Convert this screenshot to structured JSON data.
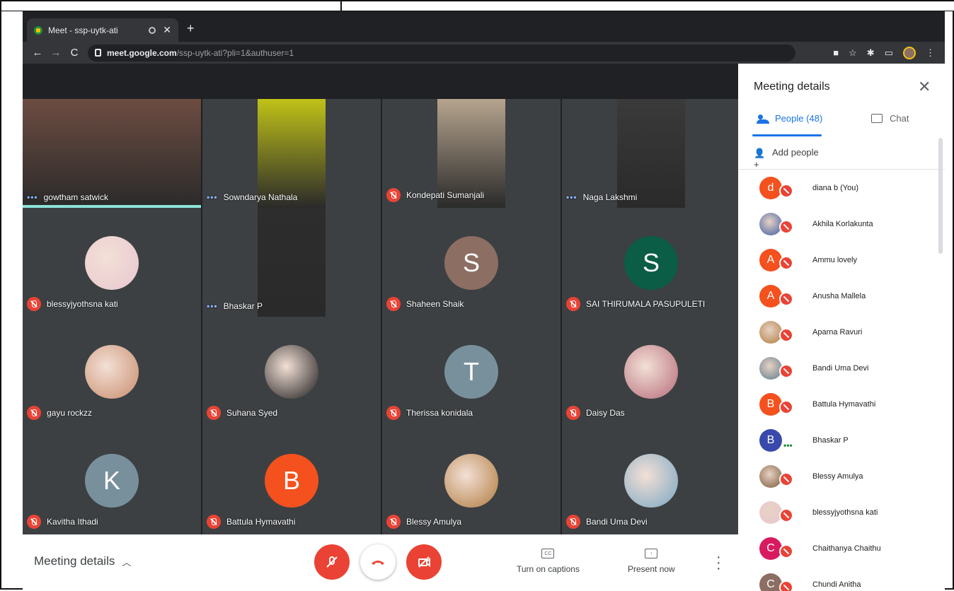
{
  "browser": {
    "tab_title": "Meet - ssp-uytk-ati",
    "url_host": "meet.google.com",
    "url_rest": "/ssp-uytk-ati?pli=1&authuser=1"
  },
  "tiles": [
    {
      "name": "gowtham satwick",
      "status": "dots",
      "kind": "video",
      "color": "#6d4c41"
    },
    {
      "name": "Sowndarya Nathala",
      "status": "dots",
      "kind": "video",
      "color": "#c0c218"
    },
    {
      "name": "Kondepati Sumanjali",
      "status": "muted",
      "kind": "video",
      "color": "#b6a48e"
    },
    {
      "name": "Naga Lakshmi",
      "status": "dots",
      "kind": "video",
      "color": "#3a3a3a"
    },
    {
      "name": "blessyjyothsna kati",
      "status": "muted",
      "kind": "photo",
      "color": "#e8c7d0"
    },
    {
      "name": "Bhaskar P",
      "status": "dots",
      "kind": "video",
      "color": "#2d2d2d"
    },
    {
      "name": "Shaheen Shaik",
      "status": "muted",
      "kind": "letter",
      "letter": "S",
      "color": "#8d6e63"
    },
    {
      "name": "SAI THIRUMALA PASUPULETI",
      "status": "muted",
      "kind": "letter",
      "letter": "S",
      "color": "#0b5d45"
    },
    {
      "name": "gayu rockzz",
      "status": "muted",
      "kind": "photo",
      "color": "#c98c6c"
    },
    {
      "name": "Suhana Syed",
      "status": "muted",
      "kind": "photo",
      "color": "#1b1b1b"
    },
    {
      "name": "Therissa konidala",
      "status": "muted",
      "kind": "letter",
      "letter": "T",
      "color": "#78909c"
    },
    {
      "name": "Daisy Das",
      "status": "muted",
      "kind": "photo",
      "color": "#b56b79"
    },
    {
      "name": "Kavitha Ithadi",
      "status": "muted",
      "kind": "letter",
      "letter": "K",
      "color": "#78909c"
    },
    {
      "name": "Battula Hymavathi",
      "status": "muted",
      "kind": "letter",
      "letter": "B",
      "color": "#f4511e"
    },
    {
      "name": "Blessy Amulya",
      "status": "muted",
      "kind": "photo",
      "color": "#b07a3c"
    },
    {
      "name": "Bandi Uma Devi",
      "status": "muted",
      "kind": "photo",
      "color": "#7aa6c2"
    }
  ],
  "bottom": {
    "meeting_details": "Meeting details",
    "captions": "Turn on captions",
    "present": "Present now"
  },
  "panel": {
    "title": "Meeting details",
    "people_tab": "People (48)",
    "chat_tab": "Chat",
    "add_people": "Add people",
    "people": [
      {
        "name": "diana b (You)",
        "letter": "d",
        "color": "#f4511e",
        "status": "muted"
      },
      {
        "name": "Akhila Korlakunta",
        "letter": "",
        "color": "#3b5ba5",
        "status": "muted"
      },
      {
        "name": "Ammu lovely",
        "letter": "A",
        "color": "#f4511e",
        "status": "muted"
      },
      {
        "name": "Anusha Mallela",
        "letter": "A",
        "color": "#f4511e",
        "status": "muted"
      },
      {
        "name": "Aparna Ravuri",
        "letter": "",
        "color": "#b07a3c",
        "status": "muted"
      },
      {
        "name": "Bandi Uma Devi",
        "letter": "",
        "color": "#5b7a8c",
        "status": "muted"
      },
      {
        "name": "Battula Hymavathi",
        "letter": "B",
        "color": "#f4511e",
        "status": "muted"
      },
      {
        "name": "Bhaskar P",
        "letter": "B",
        "color": "#3949ab",
        "status": "dots"
      },
      {
        "name": "Blessy Amulya",
        "letter": "",
        "color": "#7a5a3a",
        "status": "muted"
      },
      {
        "name": "blessyjyothsna kati",
        "letter": "",
        "color": "#e8c7d0",
        "status": "muted"
      },
      {
        "name": "Chaithanya Chaithu",
        "letter": "C",
        "color": "#d81b60",
        "status": "muted"
      },
      {
        "name": "Chundi Anitha",
        "letter": "C",
        "color": "#8d6e63",
        "status": "muted"
      }
    ]
  }
}
